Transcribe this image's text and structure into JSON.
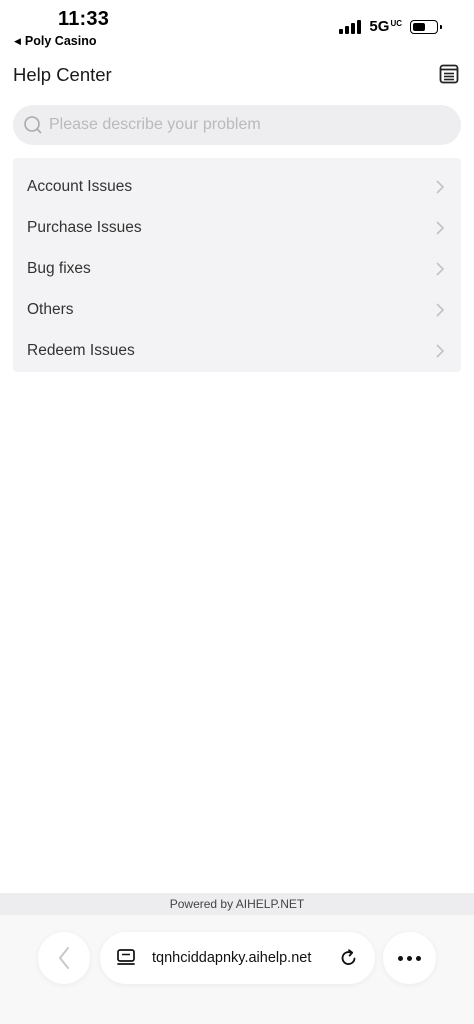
{
  "status_bar": {
    "time": "11:33",
    "back_app": "Poly Casino",
    "network": "5G",
    "network_suffix": "UC"
  },
  "header": {
    "title": "Help Center",
    "menu_icon": "list-icon"
  },
  "search": {
    "placeholder": "Please describe your problem",
    "icon": "search-icon"
  },
  "issues": [
    {
      "label": "Account Issues"
    },
    {
      "label": "Purchase Issues"
    },
    {
      "label": "Bug fixes"
    },
    {
      "label": "Others"
    },
    {
      "label": "Redeem Issues"
    }
  ],
  "footer": {
    "powered_by": "Powered by AIHELP.NET"
  },
  "browser": {
    "url": "tqnhciddapnky.aihelp.net",
    "icons": [
      "back-chevron-icon",
      "tabs-icon",
      "reload-icon",
      "more-icon"
    ]
  },
  "colors": {
    "background": "#ffffff",
    "list_background": "#f3f3f5",
    "search_background": "#eeeef0",
    "placeholder": "#b9b9be"
  }
}
